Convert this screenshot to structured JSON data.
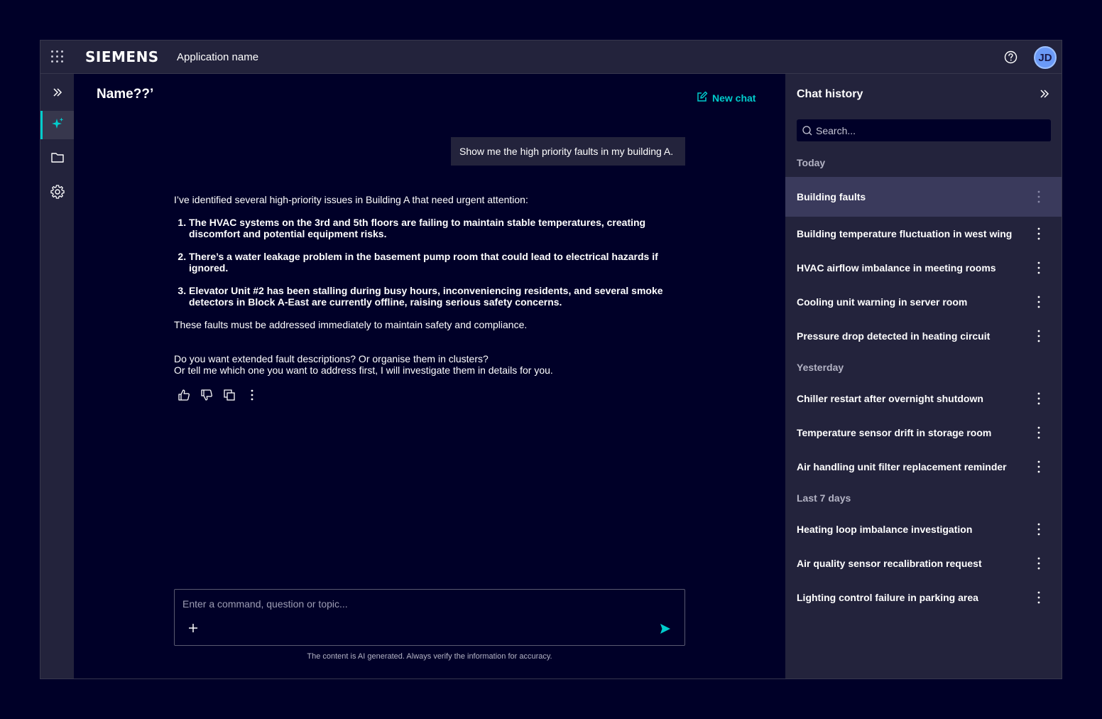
{
  "header": {
    "brand": "SIEMENS",
    "app_name": "Application name",
    "avatar_initials": "JD",
    "icons": [
      "app-switcher-icon",
      "help-icon"
    ]
  },
  "leftnav": {
    "items": [
      {
        "name": "expand",
        "icon": "chevrons-right-icon"
      },
      {
        "name": "ai-assistant",
        "icon": "sparkle-icon",
        "active": true
      },
      {
        "name": "documents",
        "icon": "folder-icon"
      },
      {
        "name": "settings",
        "icon": "gear-icon"
      }
    ]
  },
  "main": {
    "title": "Name??’",
    "new_chat_label": "New chat",
    "user_message": "Show me the high priority faults in my building A.",
    "ai_intro": "I’ve identified several high-priority issues in Building A that need urgent attention:",
    "ai_points": [
      "The HVAC systems on the 3rd and 5th floors are failing to maintain stable temperatures, creating discomfort and potential equipment risks.",
      "There’s a water leakage problem in the basement pump room that could lead to electrical hazards if ignored.",
      "Elevator Unit #2 has been stalling during busy hours, inconveniencing residents, and several smoke detectors in Block A-East are currently offline, raising serious safety concerns."
    ],
    "ai_closing": "These faults must be addressed immediately to maintain safety and compliance.",
    "ai_followup_1": "Do you want extended fault descriptions? Or organise them in clusters?",
    "ai_followup_2": "Or tell me which one you want to address first, I will investigate them in details for you.",
    "composer_placeholder": "Enter a command, question or topic...",
    "disclaimer": "The content is AI generated. Always verify the information for accuracy.",
    "accent_color": "#00cccc"
  },
  "history": {
    "title": "Chat history",
    "search_placeholder": "Search...",
    "groups": [
      {
        "label": "Today",
        "items": [
          {
            "label": "Building faults",
            "selected": true
          },
          {
            "label": "Building temperature fluctuation in west wing"
          },
          {
            "label": "HVAC airflow imbalance in meeting rooms"
          },
          {
            "label": "Cooling unit warning in server room"
          },
          {
            "label": "Pressure drop detected in heating circuit"
          }
        ]
      },
      {
        "label": "Yesterday",
        "items": [
          {
            "label": "Chiller restart after overnight shutdown"
          },
          {
            "label": "Temperature sensor drift in storage room"
          },
          {
            "label": "Air handling unit filter replacement reminder"
          }
        ]
      },
      {
        "label": "Last 7 days",
        "items": [
          {
            "label": "Heating loop imbalance investigation"
          },
          {
            "label": "Air quality sensor recalibration request"
          },
          {
            "label": "Lighting control failure in parking area"
          }
        ]
      }
    ]
  }
}
